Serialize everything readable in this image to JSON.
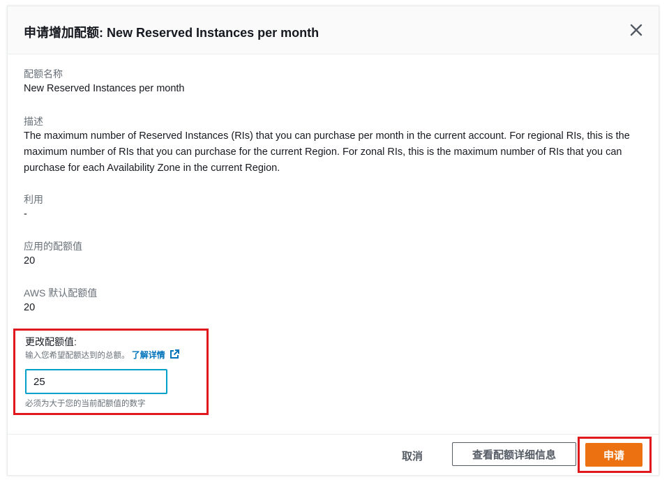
{
  "modal": {
    "title": "申请增加配额: New Reserved Instances per month"
  },
  "fields": {
    "quota_name_label": "配额名称",
    "quota_name_value": "New Reserved Instances per month",
    "description_label": "描述",
    "description_value": "The maximum number of Reserved Instances (RIs) that you can purchase per month in the current account. For regional RIs, this is the maximum number of RIs that you can purchase for the current Region. For zonal RIs, this is the maximum number of RIs that you can purchase for each Availability Zone in the current Region.",
    "utilization_label": "利用",
    "utilization_value": "-",
    "applied_label": "应用的配额值",
    "applied_value": "20",
    "default_label": "AWS 默认配额值",
    "default_value": "20"
  },
  "change": {
    "label": "更改配额值:",
    "hint": "输入您希望配额达到的总额。",
    "learn_more": "了解详情",
    "input_value": "25",
    "constraint": "必须为大于您的当前配额值的数字"
  },
  "footer": {
    "cancel": "取消",
    "details": "查看配额详细信息",
    "submit": "申请"
  },
  "colors": {
    "highlight": "#e0191f",
    "primary": "#ec7211",
    "link": "#0073bb",
    "input_focus": "#00a1c9"
  }
}
